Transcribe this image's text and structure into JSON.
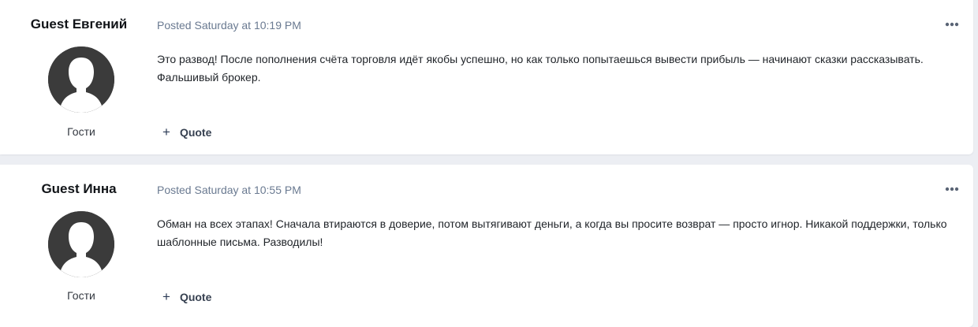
{
  "posts": [
    {
      "author": "Guest Евгений",
      "group": "Гости",
      "meta": "Posted Saturday at 10:19 PM",
      "content": "Это развод! После пополнения счёта торговля идёт якобы успешно, но как только попытаешься вывести прибыль — начинают сказки рассказывать. Фальшивый брокер.",
      "quote_label": "Quote",
      "quote_icon": "+"
    },
    {
      "author": "Guest Инна",
      "group": "Гости",
      "meta": "Posted Saturday at 10:55 PM",
      "content": "Обман на всех этапах! Сначала втираются в доверие, потом вытягивают деньги, а когда вы просите возврат — просто игнор. Никакой поддержки, только шаблонные письма. Разводилы!",
      "quote_label": "Quote",
      "quote_icon": "+"
    }
  ],
  "icons": {
    "menu": "ellipsis-icon",
    "avatar": "default-user-avatar-icon"
  },
  "colors": {
    "background": "#eceef3",
    "card": "#ffffff",
    "meta_text": "#6a7a91",
    "avatar": "#3b3b3b"
  }
}
